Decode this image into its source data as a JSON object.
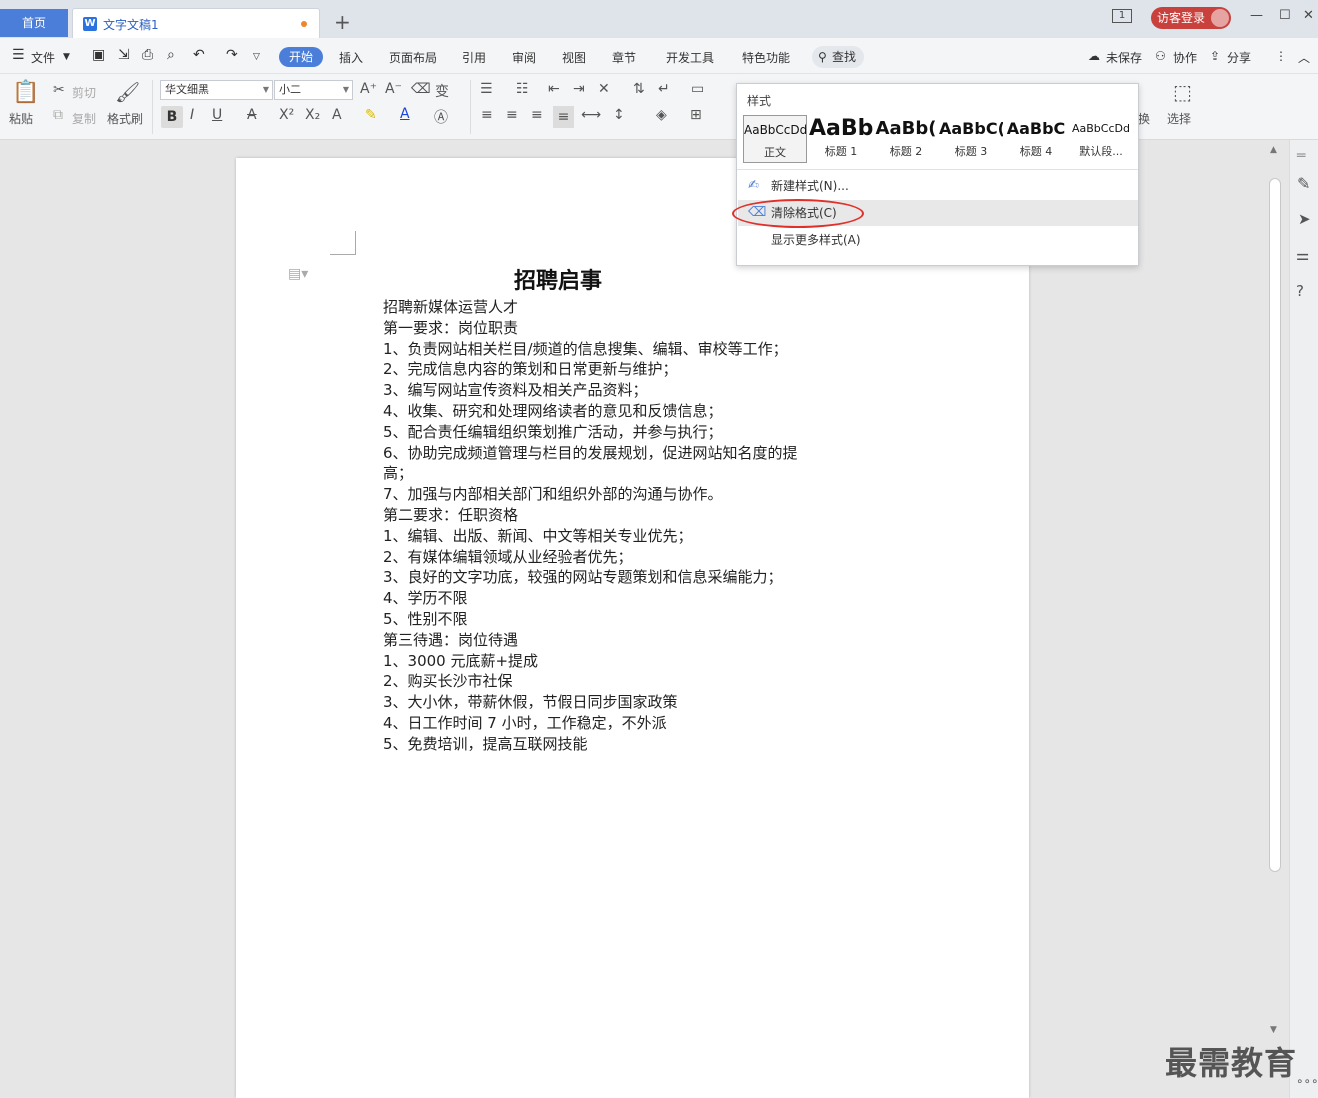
{
  "tabbar": {
    "home_tab": "首页",
    "doc_tab": "文字文稿1",
    "login_btn": "访客登录"
  },
  "menubar": {
    "file": "文件",
    "tabs": [
      "开始",
      "插入",
      "页面布局",
      "引用",
      "审阅",
      "视图",
      "章节",
      "开发工具",
      "特色功能"
    ],
    "find": "查找",
    "unsaved": "未保存",
    "collab": "协作",
    "share": "分享"
  },
  "toolbar": {
    "paste": "粘贴",
    "cut": "剪切",
    "copy": "复制",
    "format_painter": "格式刷",
    "font_name": "华文细黑",
    "font_size": "小二",
    "replace": "换",
    "select": "选择"
  },
  "styles_popup": {
    "title": "样式",
    "cards": [
      {
        "sample": "AaBbCcDd",
        "label": "正文"
      },
      {
        "sample": "AaBb",
        "label": "标题 1"
      },
      {
        "sample": "AaBb(",
        "label": "标题 2"
      },
      {
        "sample": "AaBbC(",
        "label": "标题 3"
      },
      {
        "sample": "AaBbC",
        "label": "标题 4"
      },
      {
        "sample": "AaBbCcDd",
        "label": "默认段..."
      }
    ],
    "new_style": "新建样式(N)...",
    "clear_format": "清除格式(C)",
    "more_styles": "显示更多样式(A)"
  },
  "document": {
    "title": "招聘启事",
    "lines": [
      "招聘新媒体运营人才",
      "第一要求：岗位职责",
      "1、负责网站相关栏目/频道的信息搜集、编辑、审校等工作；",
      "2、完成信息内容的策划和日常更新与维护；",
      "3、编写网站宣传资料及相关产品资料；",
      "4、收集、研究和处理网络读者的意见和反馈信息；",
      "5、配合责任编辑组织策划推广活动，并参与执行；",
      "6、协助完成频道管理与栏目的发展规划，促进网站知名度的提",
      "高；",
      "7、加强与内部相关部门和组织外部的沟通与协作。",
      "第二要求：任职资格",
      "1、编辑、出版、新闻、中文等相关专业优先；",
      "2、有媒体编辑领域从业经验者优先；",
      "3、良好的文字功底，较强的网站专题策划和信息采编能力；",
      "4、学历不限",
      "5、性别不限",
      "第三待遇：岗位待遇",
      "1、3000 元底薪+提成",
      "2、购买长沙市社保",
      "3、大小休，带薪休假，节假日同步国家政策",
      "4、日工作时间 7 小时，工作稳定，不外派",
      "5、免费培训，提高互联网技能"
    ]
  },
  "watermark": "最需教育",
  "accent_color": "#4a7ed9",
  "highlight_color": "#e0302a"
}
